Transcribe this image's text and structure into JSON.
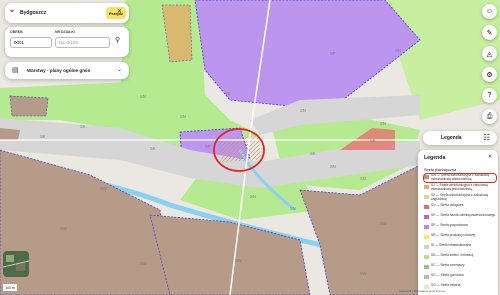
{
  "search": {
    "value": "Bydgoszcz",
    "button": "Przejdź"
  },
  "parcel_form": {
    "label_district": "OBRĘB",
    "district_value": "0001",
    "label_plot": "NR DZIAŁKI",
    "plot_placeholder": "np. 0/129"
  },
  "layer_select": {
    "label": "Warstwy - plany ogólne gmin"
  },
  "legend_button": {
    "label": "Legenda"
  },
  "legend": {
    "title": "Legenda",
    "section": "Strefa planistyczna",
    "items": [
      {
        "label": "SW — Strefa wielofunkcyjna z zabudową mieszkaniową wielorodzinną",
        "color": "#b89580"
      },
      {
        "label": "SJ — Strefa wielofunkcyjna z zabudową mieszkaniową jednorodzinną",
        "color": "#e0b06a"
      },
      {
        "label": "SZ — Strefa wielofunkcyjna z zabudową zagrodową",
        "color": "#ecd17c"
      },
      {
        "label": "SU — Strefa usługowa",
        "color": "#e86b6b"
      },
      {
        "label": "SH — Strefa handlu wielkopowierzchniowego",
        "color": "#dd5e9c"
      },
      {
        "label": "SP — Strefa gospodarcza",
        "color": "#b68be8"
      },
      {
        "label": "SR — Strefa produkcji rolniczej",
        "color": "#f1ef5c"
      },
      {
        "label": "SI — Strefa infrastrukturalna",
        "color": "#cfcfcf"
      },
      {
        "label": "SN — Strefa zieleni i rekreacji",
        "color": "#aee77f"
      },
      {
        "label": "SC — Strefa cmentarzy",
        "color": "#8fc690"
      },
      {
        "label": "SG — Strefa górnictwa",
        "color": "#b9b9b9"
      },
      {
        "label": "SO — Strefa otwarta",
        "color": "#d9f2c5"
      }
    ]
  },
  "map_labels": [
    "SN",
    "SN",
    "SN",
    "SN",
    "SN",
    "SN",
    "SN",
    "SN",
    "SN",
    "SK",
    "SK",
    "SK",
    "SK",
    "SK",
    "SK",
    "SW",
    "SW",
    "SW",
    "SW",
    "SW",
    "SW",
    "SP",
    "SP",
    "SO"
  ],
  "scale": "100 m",
  "attribution": "Geoportal / Planowanie przestrzenne",
  "colors": {
    "residential": "#b59b88",
    "industrial": "#bc95ef",
    "green": "#b6ea91",
    "rail": "#d6d6d6",
    "boundary": "#3e36d8",
    "highlight": "#e02626",
    "accent": "#f8e26a"
  }
}
